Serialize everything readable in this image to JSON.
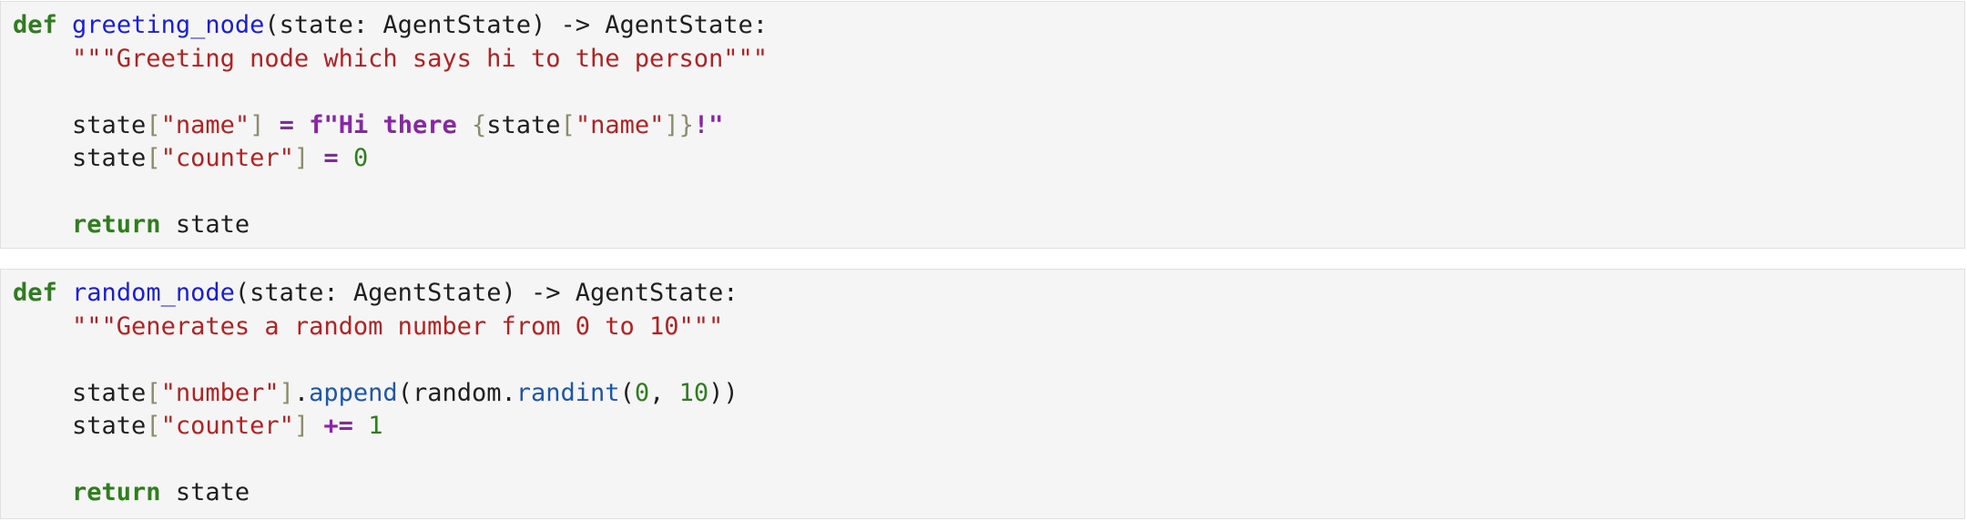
{
  "cells": [
    {
      "lines": [
        [
          {
            "t": "def",
            "c": "kw"
          },
          {
            "t": " "
          },
          {
            "t": "greeting_node",
            "c": "def"
          },
          {
            "t": "(state: AgentState) -> AgentState:"
          }
        ],
        [
          {
            "t": "    "
          },
          {
            "t": "\"\"\"Greeting node which says hi to the person\"\"\"",
            "c": "str"
          }
        ],
        [],
        [
          {
            "t": "    state"
          },
          {
            "t": "[",
            "c": "brk"
          },
          {
            "t": "\"name\"",
            "c": "str"
          },
          {
            "t": "]",
            "c": "brk"
          },
          {
            "t": " "
          },
          {
            "t": "=",
            "c": "op"
          },
          {
            "t": " "
          },
          {
            "t": "f",
            "c": "op"
          },
          {
            "t": "\"Hi there ",
            "c": "op"
          },
          {
            "t": "{",
            "c": "brk"
          },
          {
            "t": "state"
          },
          {
            "t": "[",
            "c": "brk"
          },
          {
            "t": "\"name\"",
            "c": "str"
          },
          {
            "t": "]",
            "c": "brk"
          },
          {
            "t": "}",
            "c": "brk"
          },
          {
            "t": "!\"",
            "c": "op"
          }
        ],
        [
          {
            "t": "    state"
          },
          {
            "t": "[",
            "c": "brk"
          },
          {
            "t": "\"counter\"",
            "c": "str"
          },
          {
            "t": "]",
            "c": "brk"
          },
          {
            "t": " "
          },
          {
            "t": "=",
            "c": "op"
          },
          {
            "t": " "
          },
          {
            "t": "0",
            "c": "num"
          }
        ],
        [],
        [
          {
            "t": "    "
          },
          {
            "t": "return",
            "c": "kw"
          },
          {
            "t": " state"
          }
        ]
      ]
    },
    {
      "lines": [
        [
          {
            "t": "def",
            "c": "kw"
          },
          {
            "t": " "
          },
          {
            "t": "random_node",
            "c": "def"
          },
          {
            "t": "(state: AgentState) -> AgentState:"
          }
        ],
        [
          {
            "t": "    "
          },
          {
            "t": "\"\"\"Generates a random number from 0 to 10\"\"\"",
            "c": "str"
          }
        ],
        [],
        [
          {
            "t": "    state"
          },
          {
            "t": "[",
            "c": "brk"
          },
          {
            "t": "\"number\"",
            "c": "str"
          },
          {
            "t": "]",
            "c": "brk"
          },
          {
            "t": "."
          },
          {
            "t": "append",
            "c": "attr"
          },
          {
            "t": "(random."
          },
          {
            "t": "randint",
            "c": "attr"
          },
          {
            "t": "("
          },
          {
            "t": "0",
            "c": "num"
          },
          {
            "t": ", "
          },
          {
            "t": "10",
            "c": "num"
          },
          {
            "t": "))"
          }
        ],
        [
          {
            "t": "    state"
          },
          {
            "t": "[",
            "c": "brk"
          },
          {
            "t": "\"counter\"",
            "c": "str"
          },
          {
            "t": "]",
            "c": "brk"
          },
          {
            "t": " "
          },
          {
            "t": "+=",
            "c": "op"
          },
          {
            "t": " "
          },
          {
            "t": "1",
            "c": "num"
          }
        ],
        [],
        [
          {
            "t": "    "
          },
          {
            "t": "return",
            "c": "kw"
          },
          {
            "t": " state"
          }
        ]
      ]
    }
  ]
}
